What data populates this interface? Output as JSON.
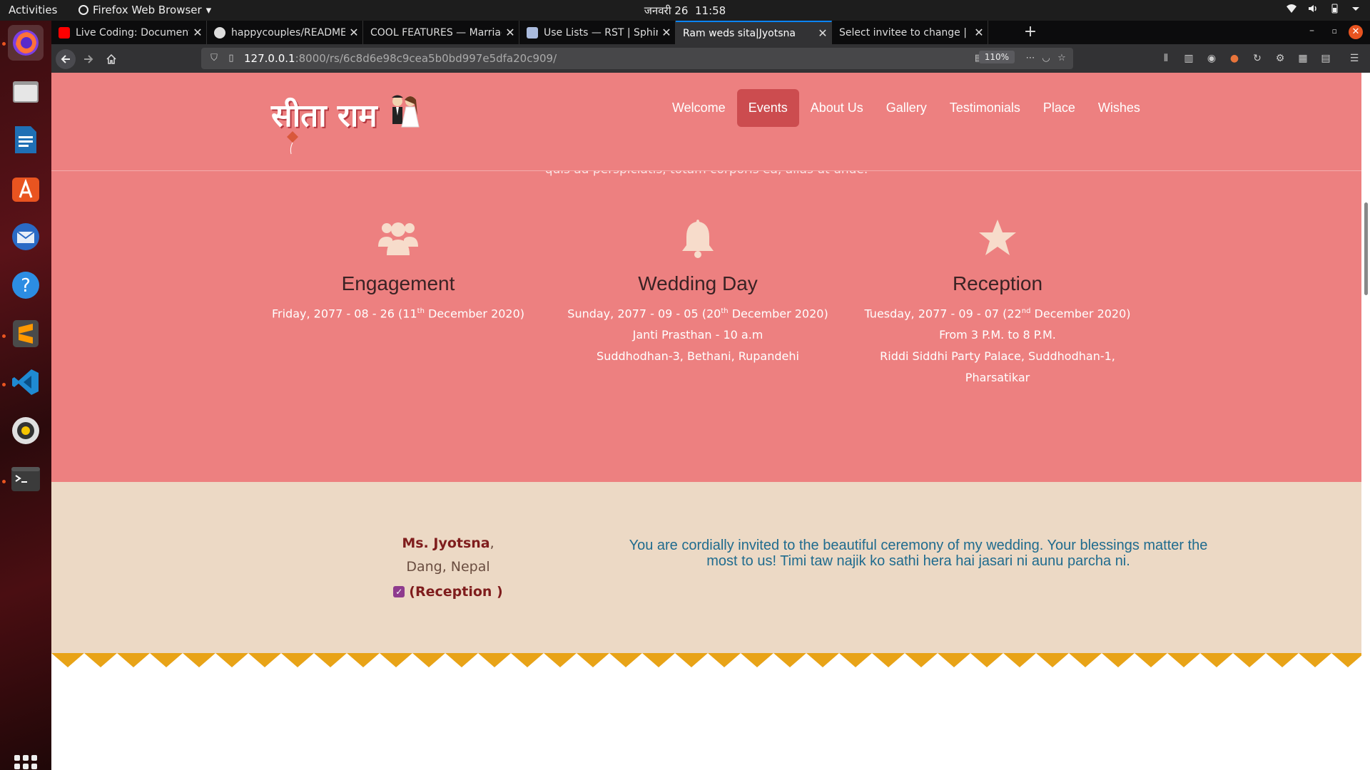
{
  "topbar": {
    "activities": "Activities",
    "app_name": "Firefox Web Browser",
    "date": "जनवरी 26",
    "time": "11:58"
  },
  "tabs": [
    {
      "title": "Live Coding: Documentati",
      "favicon_color": "#ff0000"
    },
    {
      "title": "happycouples/README.m",
      "favicon_color": "#ffffff"
    },
    {
      "title": "COOL FEATURES — Marriag",
      "favicon_color": "#888888"
    },
    {
      "title": "Use Lists — RST | Sphinx",
      "favicon_color": "#aabbdd"
    },
    {
      "title": "Ram weds sita|Jyotsna",
      "favicon_color": "#ed8080"
    },
    {
      "title": "Select invitee to change | Dj",
      "favicon_color": "#0c4b33"
    }
  ],
  "browser": {
    "url_host": "127.0.0.1",
    "url_rest": ":8000/rs/6c8d6e98c9cea5b0bd997e5dfa20c909/",
    "zoom": "110%"
  },
  "site": {
    "logo_text": "सीता राम",
    "nav": [
      "Welcome",
      "Events",
      "About Us",
      "Gallery",
      "Testimonials",
      "Place",
      "Wishes"
    ],
    "active_nav": "Events",
    "cut_text": "quis ad perspiciatis, totam corporis ea, alias ut unde.",
    "events": [
      {
        "icon": "users-icon",
        "title": "Engagement",
        "date_pre": "Friday, 2077 - 08 - 26 (11",
        "date_sup": "th",
        "date_post": " December 2020)",
        "lines": []
      },
      {
        "icon": "bell-icon",
        "title": "Wedding Day",
        "date_pre": "Sunday, 2077 - 09 - 05 (20",
        "date_sup": "th",
        "date_post": " December 2020)",
        "lines": [
          "Janti Prasthan - 10 a.m",
          "Suddhodhan-3, Bethani, Rupandehi"
        ]
      },
      {
        "icon": "star-icon",
        "title": "Reception",
        "date_pre": "Tuesday, 2077 - 09 - 07 (22",
        "date_sup": "nd",
        "date_post": " December 2020)",
        "lines": [
          "From 3 P.M. to 8 P.M.",
          "Riddi Siddhi Party Palace, Suddhodhan-1,",
          "Pharsatikar"
        ]
      }
    ],
    "guest": {
      "name": "Ms. Jyotsna",
      "name_suffix": ",",
      "address": "Dang, Nepal",
      "event": "(Reception )"
    },
    "invite_message": "You are cordially invited to the beautiful ceremony of my wedding. Your blessings matter the most to us! Timi taw najik ko sathi hera hai jasari ni aunu parcha ni."
  },
  "colors": {
    "header_bg": "#ed8080",
    "active_nav": "#cc4c4f",
    "invite_bg": "#ecd9c5",
    "zigzag": "#e8a317",
    "icon_cream": "#f7dccb"
  }
}
